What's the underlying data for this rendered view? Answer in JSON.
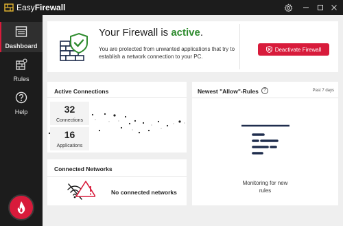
{
  "app": {
    "title_prefix": "Easy",
    "title_bold": "Firewall"
  },
  "sidebar": {
    "items": [
      {
        "label": "Dashboard",
        "icon": "dashboard-icon",
        "active": true
      },
      {
        "label": "Rules",
        "icon": "rules-icon",
        "active": false
      },
      {
        "label": "Help",
        "icon": "help-icon",
        "active": false
      }
    ]
  },
  "status": {
    "title_prefix": "Your Firewall is ",
    "title_state": "active",
    "title_suffix": ".",
    "description": "You are protected from unwanted applications that try to establish a network connection to your PC.",
    "button_label": "Deactivate Firewall"
  },
  "connections": {
    "title": "Active Connections",
    "connections_count": "32",
    "connections_label": "Connections",
    "applications_count": "16",
    "applications_label": "Applications"
  },
  "networks": {
    "title": "Connected Networks",
    "empty_text": "No connected networks"
  },
  "rules": {
    "title": "Newest \"Allow\"-Rules",
    "period": "Past 7 days",
    "empty_text": "Monitoring for new rules"
  },
  "colors": {
    "accent": "#d81b3b",
    "active_green": "#2e8b2e",
    "sidebar_bg": "#1c1c1c",
    "main_bg": "#efefef",
    "icon_navy": "#1f2d4d"
  }
}
